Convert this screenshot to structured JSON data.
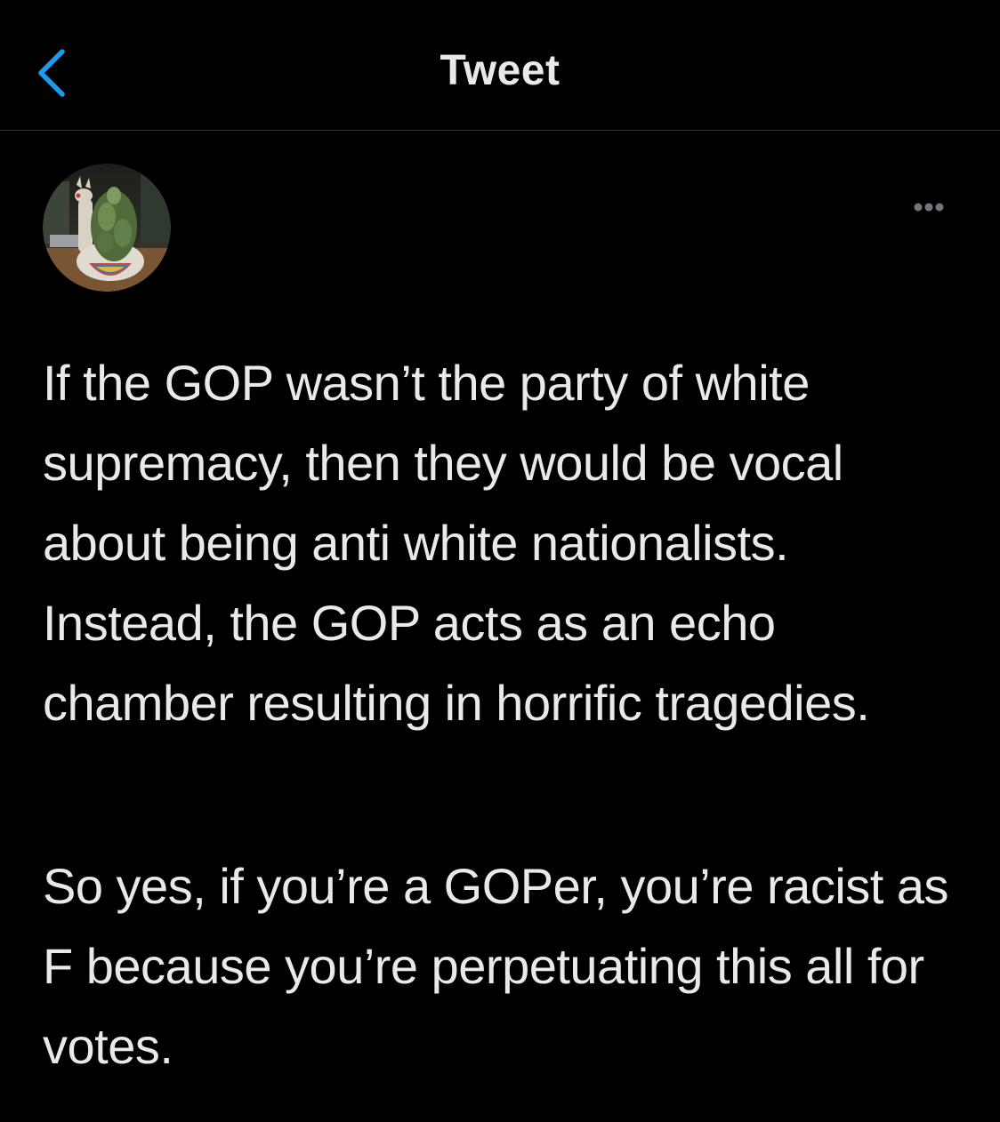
{
  "header": {
    "title": "Tweet",
    "back_icon": "chevron-left-icon",
    "accent_color": "#1d9bf0"
  },
  "author": {
    "display_name": "",
    "avatar_icon": "avatar-llama-planter"
  },
  "more_icon": "ellipsis-icon",
  "tweet": {
    "paragraphs": [
      "If the GOP wasn’t the party of white supremacy, then they would be vocal about being anti white nationalists. Instead, the GOP acts as an echo chamber resulting in horrific tragedies.",
      "So yes, if you’re a GOPer, you’re racist as F because you’re perpetuating this all for votes."
    ]
  }
}
